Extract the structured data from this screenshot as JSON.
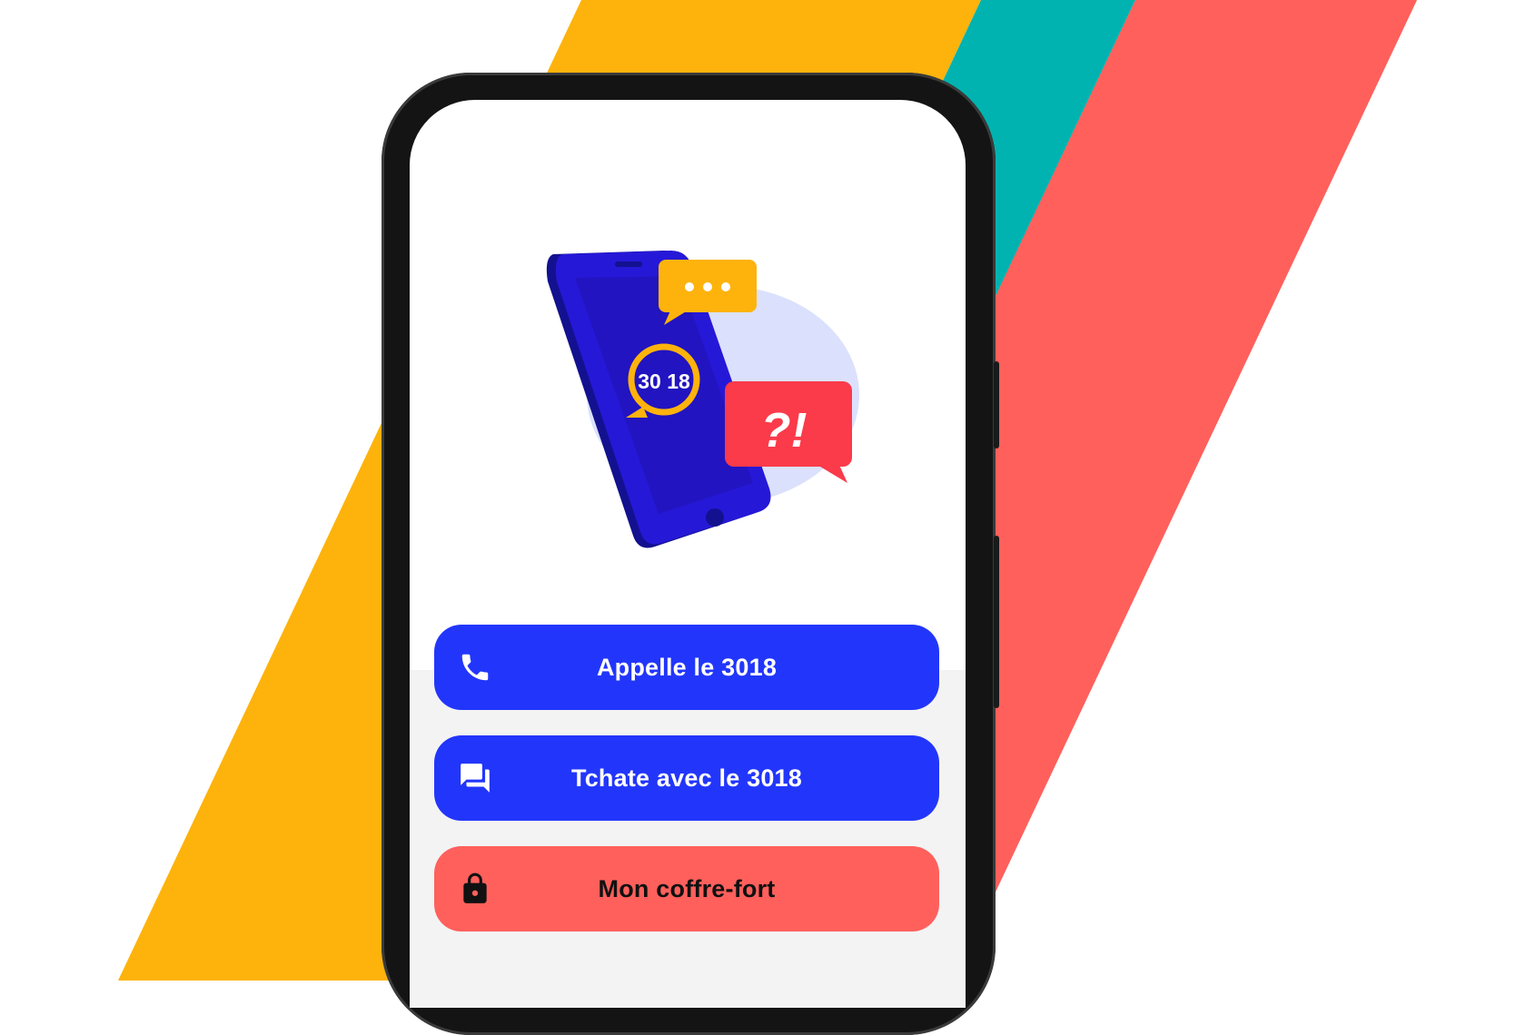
{
  "colors": {
    "stripe_yellow": "#fdb30c",
    "stripe_teal": "#00b3b0",
    "stripe_red": "#ff605c",
    "device_frame": "#141414",
    "primary_blue": "#2236fb",
    "vault_red": "#ff605c",
    "screen_bg": "#ffffff",
    "screen_lower_bg": "#f3f3f3"
  },
  "illustration": {
    "badge_text": "30 18",
    "question_bubble_text": "?!"
  },
  "buttons": [
    {
      "label": "Appelle le 3018",
      "icon": "phone-icon"
    },
    {
      "label": "Tchate avec le 3018",
      "icon": "chat-bubbles-icon"
    },
    {
      "label": "Mon coffre-fort",
      "icon": "lock-icon"
    }
  ]
}
